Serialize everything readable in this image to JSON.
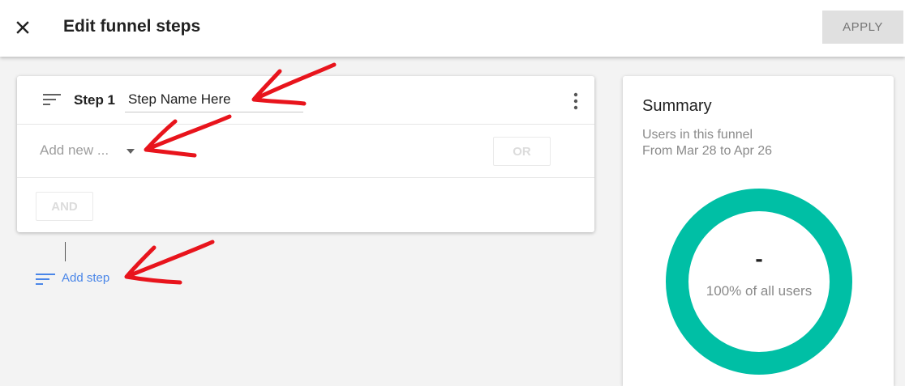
{
  "header": {
    "title": "Edit funnel steps",
    "apply_label": "APPLY",
    "close_icon": "close-icon"
  },
  "step": {
    "label": "Step 1",
    "name_value": "Step Name Here",
    "condition_placeholder": "Add new ...",
    "or_label": "OR",
    "and_label": "AND"
  },
  "add_step": {
    "label": "Add step"
  },
  "summary": {
    "title": "Summary",
    "subtitle_line1": "Users in this funnel",
    "subtitle_line2": "From Mar 28 to Apr 26",
    "value": "-",
    "caption": "100% of all users",
    "fraction": 1.0
  },
  "colors": {
    "accent": "#4a86e8",
    "donut": "#00bfa5",
    "annotation": "#e8141c"
  }
}
